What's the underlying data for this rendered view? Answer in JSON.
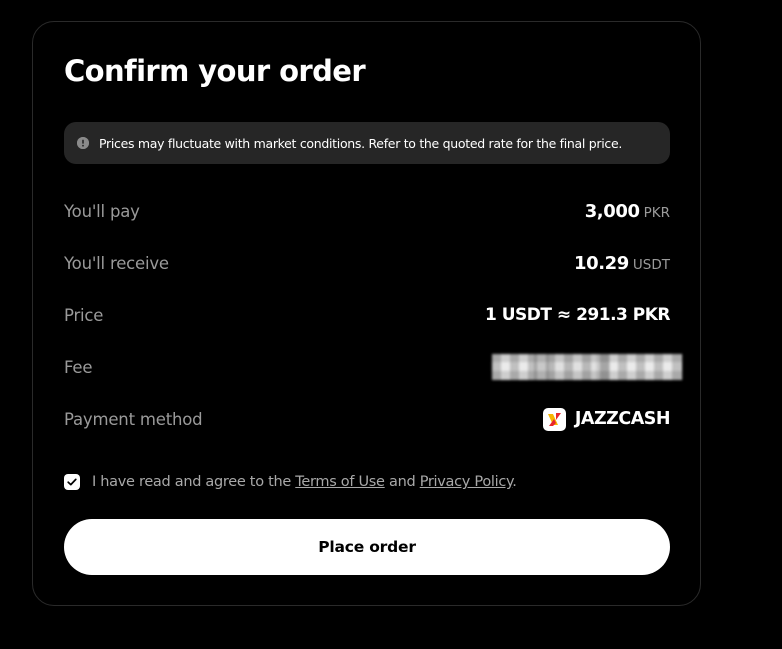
{
  "title": "Confirm your order",
  "notice": {
    "icon": "info-icon",
    "text": "Prices may fluctuate with market conditions. Refer to the quoted rate for the final price."
  },
  "rows": {
    "pay": {
      "label": "You'll pay",
      "value": "3,000",
      "unit": "PKR"
    },
    "receive": {
      "label": "You'll receive",
      "value": "10.29",
      "unit": "USDT"
    },
    "price": {
      "label": "Price",
      "value": "1 USDT ≈ 291.3 PKR"
    },
    "fee": {
      "label": "Fee",
      "value_redacted": true
    },
    "payment": {
      "label": "Payment method",
      "value": "JAZZCASH",
      "icon": "jazzcash-logo"
    }
  },
  "agreement": {
    "checked": true,
    "prefix": "I have read and agree to the",
    "terms": "Terms of Use",
    "and": "and",
    "privacy": "Privacy Policy",
    "suffix": "."
  },
  "button": {
    "label": "Place order"
  },
  "colors": {
    "background": "#000000",
    "notice_bg": "#262626",
    "label_gray": "#9a9a9a",
    "jazzcash_red": "#e8262c",
    "jazzcash_yellow": "#f7b500"
  }
}
